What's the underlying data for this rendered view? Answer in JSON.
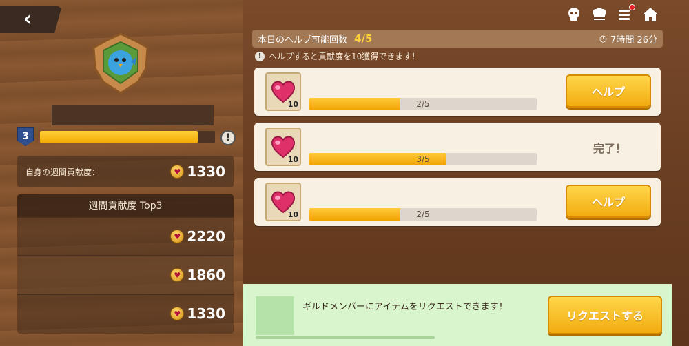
{
  "player": {
    "level": "3",
    "xp_fraction": 0.9
  },
  "my_weekly": {
    "label": "自身の週間貢献度：",
    "score": "1330"
  },
  "top3": {
    "title": "週間貢献度 Top3",
    "scores": [
      "2220",
      "1860",
      "1330"
    ]
  },
  "help_header": {
    "title": "本日のヘルプ可能回数",
    "count": "4/5",
    "timer": "7時間 26分"
  },
  "help_note": "ヘルプすると貢献度を10獲得できます！",
  "requests": [
    {
      "qty": "10",
      "progress_text": "2/5",
      "fraction": 0.4,
      "action": "ヘルプ",
      "done": false
    },
    {
      "qty": "10",
      "progress_text": "3/5",
      "fraction": 0.6,
      "action": "完了！",
      "done": true
    },
    {
      "qty": "10",
      "progress_text": "2/5",
      "fraction": 0.4,
      "action": "ヘルプ",
      "done": false
    }
  ],
  "bottom": {
    "message": "ギルドメンバーにアイテムをリクエストできます！",
    "button": "リクエストする"
  },
  "icons": [
    "back-icon",
    "skull-icon",
    "chef-hat-icon",
    "menu-icon",
    "home-icon",
    "clock-icon",
    "heart-item-icon",
    "coin-icon",
    "info-icon"
  ],
  "colors": {
    "accent": "#f2ac10",
    "progress": "#efa300",
    "bottom_bar": "#d8f5cd"
  }
}
